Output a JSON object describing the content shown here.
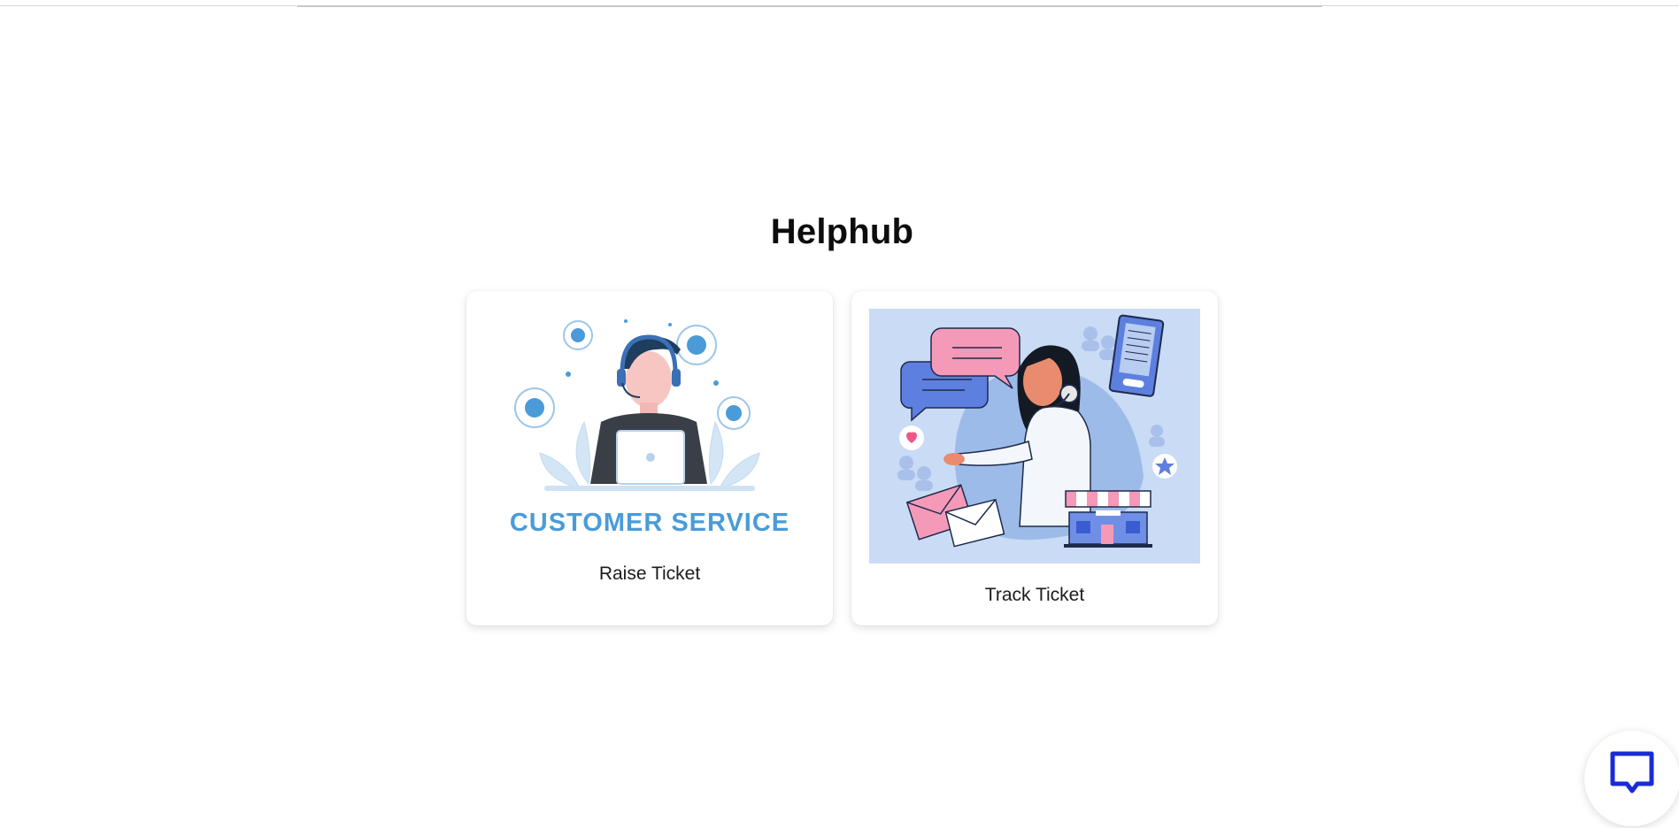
{
  "page": {
    "title": "Helphub"
  },
  "cards": [
    {
      "label": "Raise Ticket",
      "image_text": "CUSTOMER SERVICE",
      "image": "customer-service-agent-illustration"
    },
    {
      "label": "Track Ticket",
      "image": "support-agent-with-chat-bubbles-illustration"
    }
  ],
  "chat_widget": {
    "icon": "chat-bubble-icon"
  },
  "colors": {
    "accent_blue": "#4a9bd8",
    "chat_icon": "#1a2bd6",
    "track_bg": "#c9dbf5",
    "bubble_pink": "#f49ab8",
    "bubble_blue": "#5d7fe0"
  }
}
